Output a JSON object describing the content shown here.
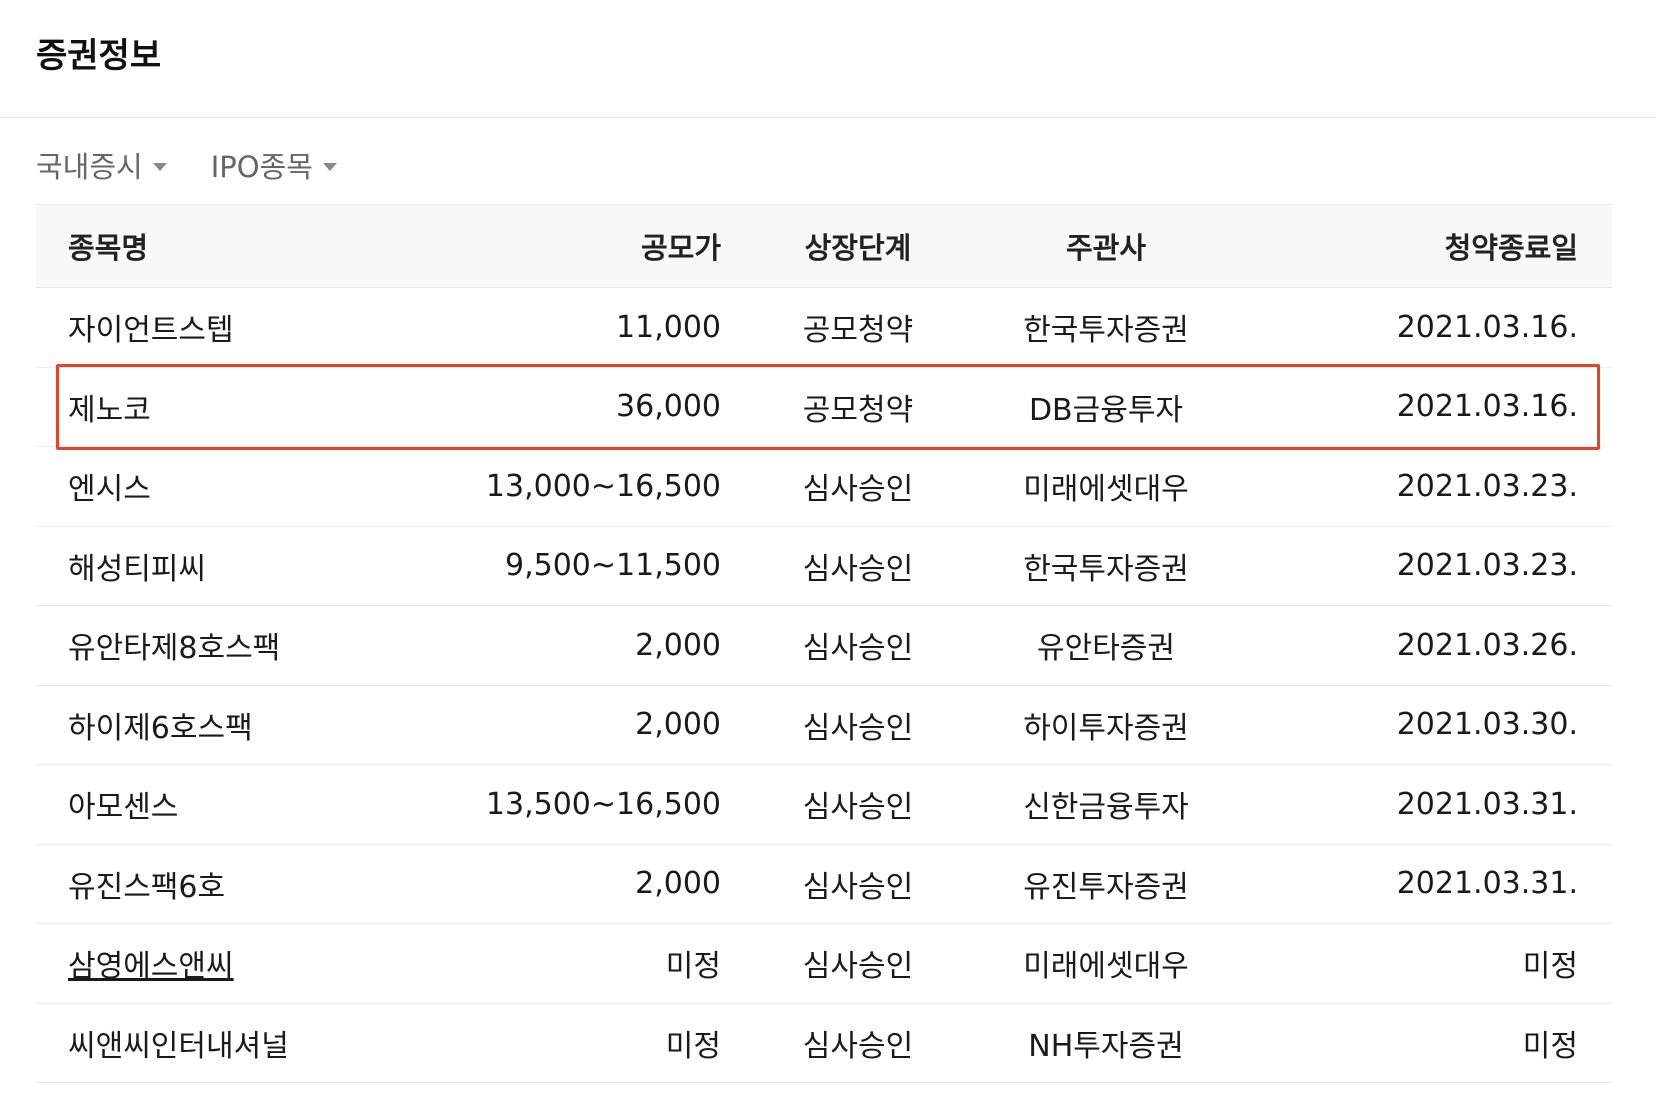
{
  "header": {
    "title": "증권정보"
  },
  "filters": [
    {
      "label": "국내증시"
    },
    {
      "label": "IPO종목"
    }
  ],
  "table": {
    "columns": {
      "name": "종목명",
      "price": "공모가",
      "stage": "상장단계",
      "lead": "주관사",
      "end_date": "청약종료일"
    },
    "rows": [
      {
        "name": "자이언트스텝",
        "price": "11,000",
        "stage": "공모청약",
        "lead": "한국투자증권",
        "end_date": "2021.03.16."
      },
      {
        "name": "제노코",
        "price": "36,000",
        "stage": "공모청약",
        "lead": "DB금융투자",
        "end_date": "2021.03.16."
      },
      {
        "name": "엔시스",
        "price": "13,000~16,500",
        "stage": "심사승인",
        "lead": "미래에셋대우",
        "end_date": "2021.03.23."
      },
      {
        "name": "해성티피씨",
        "price": "9,500~11,500",
        "stage": "심사승인",
        "lead": "한국투자증권",
        "end_date": "2021.03.23."
      },
      {
        "name": "유안타제8호스팩",
        "price": "2,000",
        "stage": "심사승인",
        "lead": "유안타증권",
        "end_date": "2021.03.26."
      },
      {
        "name": "하이제6호스팩",
        "price": "2,000",
        "stage": "심사승인",
        "lead": "하이투자증권",
        "end_date": "2021.03.30."
      },
      {
        "name": "아모센스",
        "price": "13,500~16,500",
        "stage": "심사승인",
        "lead": "신한금융투자",
        "end_date": "2021.03.31."
      },
      {
        "name": "유진스팩6호",
        "price": "2,000",
        "stage": "심사승인",
        "lead": "유진투자증권",
        "end_date": "2021.03.31."
      },
      {
        "name": "삼영에스앤씨",
        "price": "미정",
        "stage": "심사승인",
        "lead": "미래에셋대우",
        "end_date": "미정"
      },
      {
        "name": "씨앤씨인터내셔널",
        "price": "미정",
        "stage": "심사승인",
        "lead": "NH투자증권",
        "end_date": "미정"
      }
    ]
  },
  "colors": {
    "highlight_border": "#e0452b",
    "header_bg": "#f8f8f8",
    "divider": "#e6e6e6",
    "muted_text": "#666666"
  }
}
